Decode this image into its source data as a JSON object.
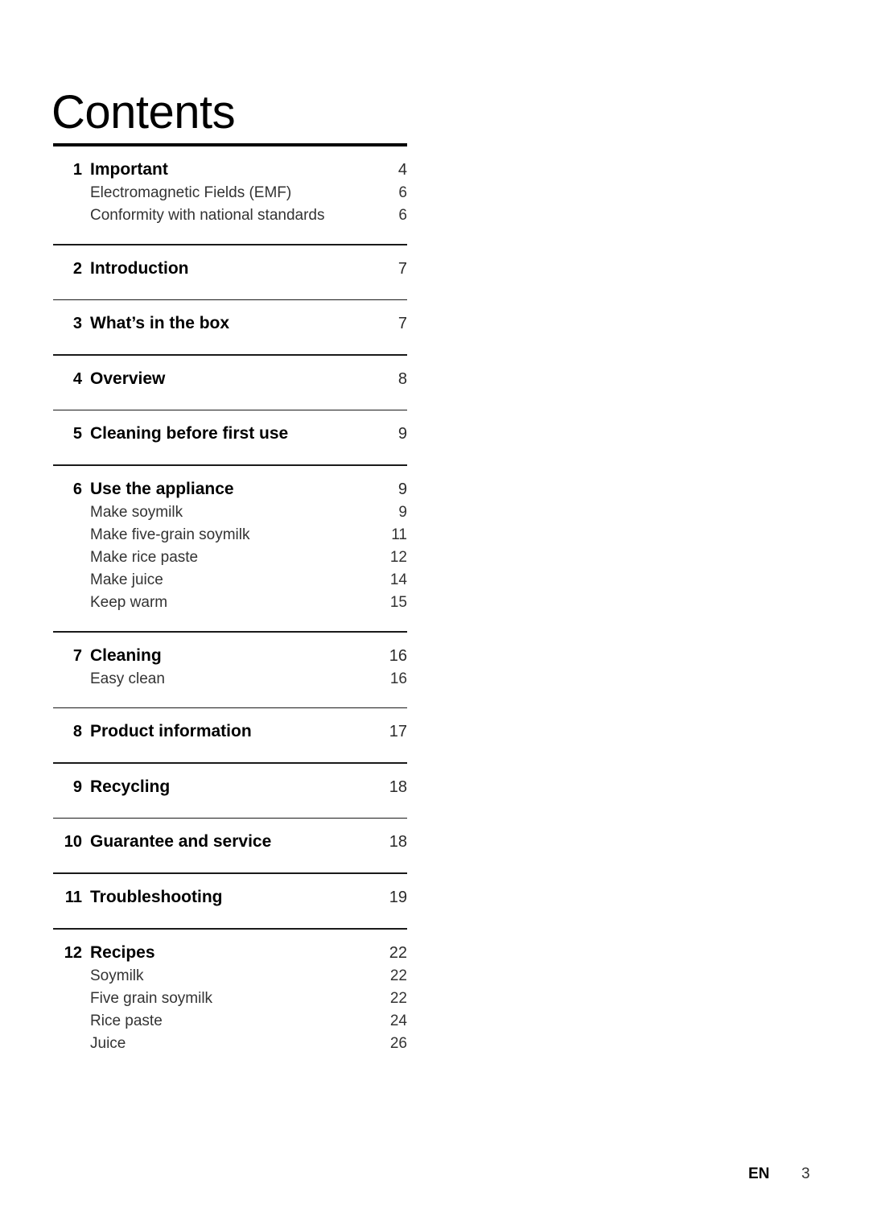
{
  "document": {
    "title": "Contents"
  },
  "toc": {
    "entries": [
      {
        "number": "1",
        "label": "Important",
        "page": "4",
        "rule": "thick",
        "sub": [
          {
            "label": "Electromagnetic Fields (EMF)",
            "page": "6"
          },
          {
            "label": "Conformity with national standards",
            "page": "6"
          }
        ]
      },
      {
        "number": "2",
        "label": "Introduction",
        "page": "7",
        "rule": "thin",
        "sub": []
      },
      {
        "number": "3",
        "label": "What’s in the box",
        "page": "7",
        "rule": "thin",
        "sub": []
      },
      {
        "number": "4",
        "label": "Overview",
        "page": "8",
        "rule": "thin",
        "sub": []
      },
      {
        "number": "5",
        "label": "Cleaning before first use",
        "page": "9",
        "rule": "thin",
        "sub": []
      },
      {
        "number": "6",
        "label": "Use the appliance",
        "page": "9",
        "rule": "thin",
        "sub": [
          {
            "label": "Make soymilk",
            "page": "9"
          },
          {
            "label": "Make five-grain soymilk",
            "page": "11"
          },
          {
            "label": "Make rice paste",
            "page": "12"
          },
          {
            "label": "Make juice",
            "page": "14"
          },
          {
            "label": "Keep warm",
            "page": "15"
          }
        ]
      },
      {
        "number": "7",
        "label": "Cleaning",
        "page": "16",
        "rule": "thin",
        "sub": [
          {
            "label": "Easy clean",
            "page": "16"
          }
        ]
      },
      {
        "number": "8",
        "label": "Product information",
        "page": "17",
        "rule": "thin",
        "sub": []
      },
      {
        "number": "9",
        "label": "Recycling",
        "page": "18",
        "rule": "thin",
        "sub": []
      },
      {
        "number": "10",
        "label": "Guarantee and service",
        "page": "18",
        "rule": "thin",
        "sub": []
      },
      {
        "number": "11",
        "label": "Troubleshooting",
        "page": "19",
        "rule": "thin",
        "sub": []
      },
      {
        "number": "12",
        "label": "Recipes",
        "page": "22",
        "rule": "thin",
        "sub": [
          {
            "label": "Soymilk",
            "page": "22"
          },
          {
            "label": "Five grain soymilk",
            "page": "22"
          },
          {
            "label": "Rice paste",
            "page": "24"
          },
          {
            "label": "Juice",
            "page": "26"
          }
        ]
      }
    ]
  },
  "footer": {
    "language": "EN",
    "page_number": "3"
  },
  "colors": {
    "text": "#000000",
    "subtext": "#333333",
    "rule": "#000000",
    "background": "#ffffff"
  }
}
